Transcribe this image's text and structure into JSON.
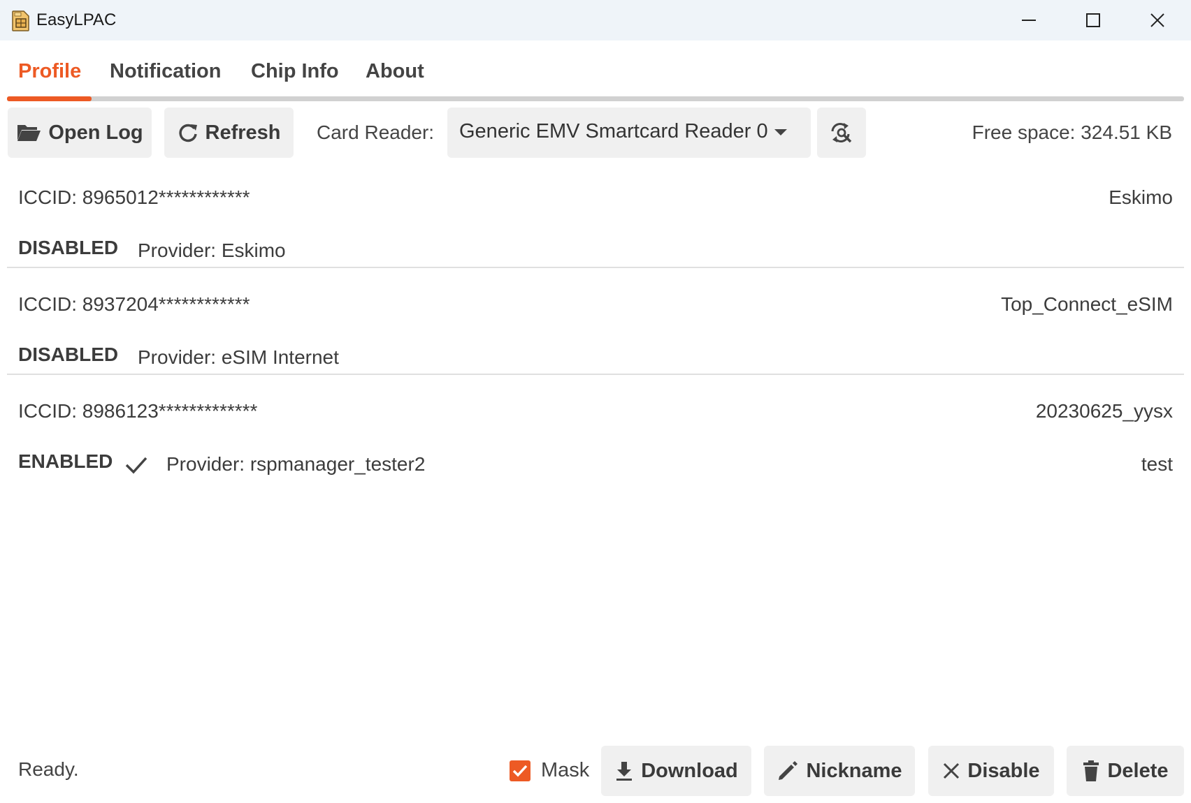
{
  "window": {
    "title": "EasyLPAC",
    "controls": [
      "minimize-icon",
      "maximize-icon",
      "close-icon"
    ]
  },
  "tabs": [
    {
      "label": "Profile",
      "active": true
    },
    {
      "label": "Notification",
      "active": false
    },
    {
      "label": "Chip Info",
      "active": false
    },
    {
      "label": "About",
      "active": false
    }
  ],
  "toolbar": {
    "open_log": {
      "label": "Open Log",
      "icon": "folder-open-icon"
    },
    "refresh": {
      "label": "Refresh",
      "icon": "refresh-icon"
    },
    "card_reader_label": "Card Reader:",
    "card_reader_value": "Generic EMV Smartcard Reader 0",
    "scan_icon": "refresh-search-icon",
    "free_space": "Free space: 324.51 KB"
  },
  "profiles": [
    {
      "iccid": "ICCID: 8965012************",
      "name": "Eskimo",
      "state": "DISABLED",
      "provider": "Provider: Eskimo",
      "nickname": "",
      "enabled": false
    },
    {
      "iccid": "ICCID: 8937204************",
      "name": "Top_Connect_eSIM",
      "state": "DISABLED",
      "provider": "Provider: eSIM Internet",
      "nickname": "",
      "enabled": false
    },
    {
      "iccid": "ICCID: 8986123*************",
      "name": "20230625_yysx",
      "state": "ENABLED",
      "provider": "Provider: rspmanager_tester2",
      "nickname": "test",
      "enabled": true
    }
  ],
  "bottom": {
    "status": "Ready.",
    "mask_label": "Mask",
    "mask_checked": true,
    "download": "Download",
    "nickname": "Nickname",
    "disable": "Disable",
    "delete": "Delete"
  },
  "colors": {
    "accent": "#ed5a24",
    "button_bg": "#f0f0f0",
    "titlebar_bg": "#eff4f9"
  }
}
